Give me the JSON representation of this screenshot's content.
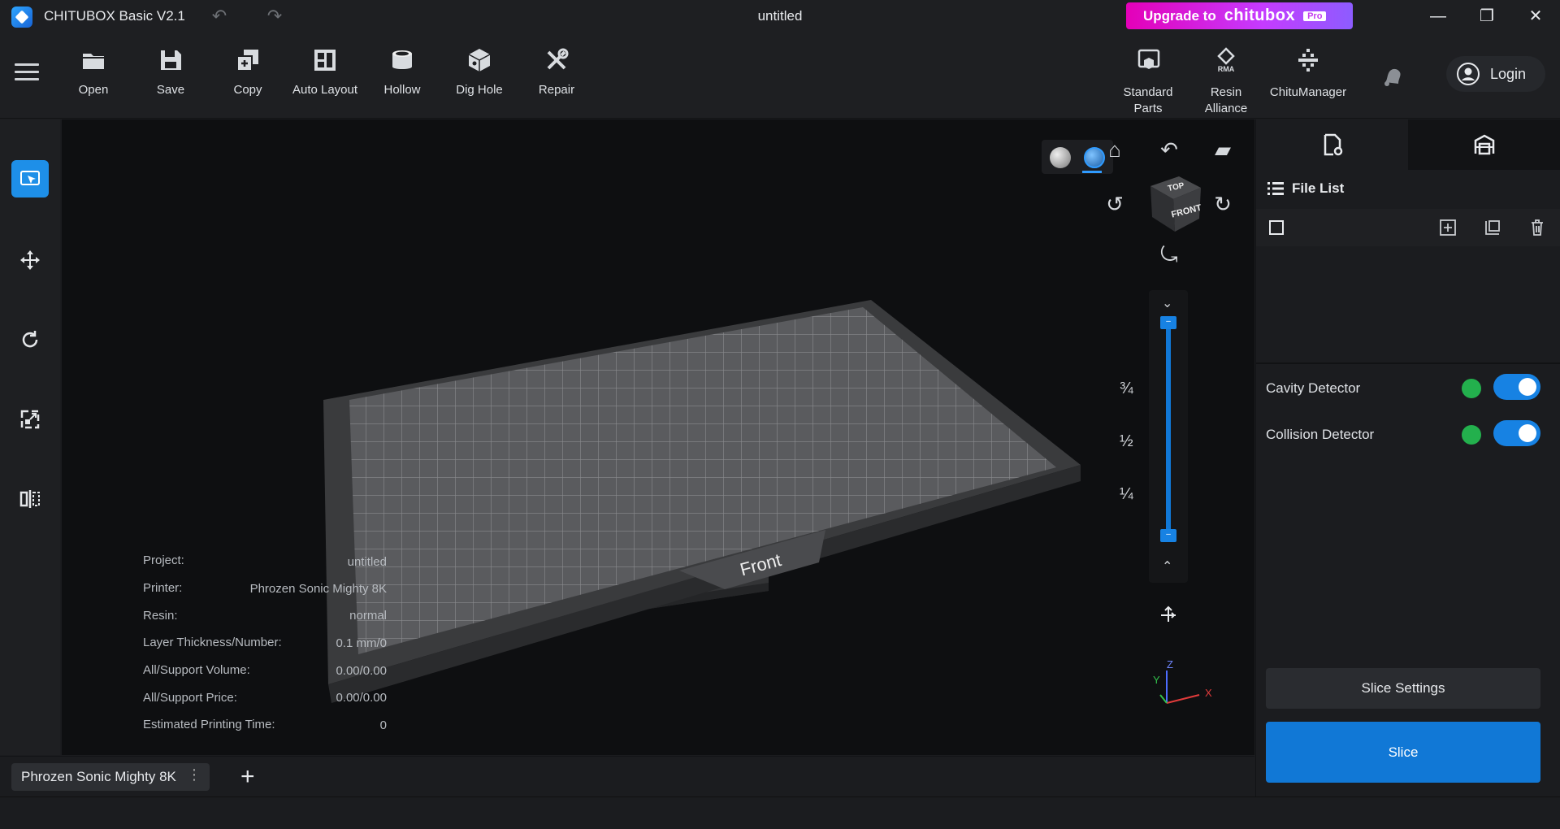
{
  "app": {
    "title": "CHITUBOX Basic V2.1",
    "document_title": "untitled"
  },
  "upgrade": {
    "prefix": "Upgrade to",
    "brand": "chitubox",
    "badge": "Pro"
  },
  "toolbar": {
    "tools": [
      {
        "label": "Open",
        "icon": "folder-icon"
      },
      {
        "label": "Save",
        "icon": "save-icon"
      },
      {
        "label": "Copy",
        "icon": "copy-icon"
      },
      {
        "label": "Auto Layout",
        "icon": "auto-layout-icon"
      },
      {
        "label": "Hollow",
        "icon": "hollow-icon"
      },
      {
        "label": "Dig Hole",
        "icon": "dig-hole-icon"
      },
      {
        "label": "Repair",
        "icon": "repair-icon"
      }
    ],
    "right_tools": [
      {
        "label_line1": "Standard",
        "label_line2": "Parts",
        "icon": "standard-parts-icon"
      },
      {
        "label_line1": "Resin",
        "label_line2": "Alliance",
        "icon": "resin-alliance-icon",
        "icon_text": "RMA"
      },
      {
        "label_line1": "ChituManager",
        "label_line2": "",
        "icon": "chitumanager-icon"
      }
    ],
    "login_label": "Login"
  },
  "viewport": {
    "cube_top": "TOP",
    "cube_front": "FRONT",
    "plate_label": "Front",
    "slider_fractions": [
      "¾",
      "½",
      "¼"
    ],
    "axes": {
      "x": "X",
      "y": "Y",
      "z": "Z"
    }
  },
  "info": {
    "rows": [
      {
        "label": "Project:",
        "value": "untitled"
      },
      {
        "label": "Printer:",
        "value": "Phrozen Sonic Mighty 8K"
      },
      {
        "label": "Resin:",
        "value": "normal"
      },
      {
        "label": "Layer Thickness/Number:",
        "value": "0.1 mm/0"
      },
      {
        "label": "All/Support Volume:",
        "value": "0.00/0.00"
      },
      {
        "label": "All/Support Price:",
        "value": "0.00/0.00"
      },
      {
        "label": "Estimated Printing Time:",
        "value": "0"
      }
    ]
  },
  "bottom": {
    "printer_tab": "Phrozen Sonic Mighty 8K",
    "add_tab": "+"
  },
  "right_panel": {
    "file_list_title": "File List",
    "detectors": [
      {
        "label": "Cavity Detector",
        "enabled": true
      },
      {
        "label": "Collision Detector",
        "enabled": true
      }
    ],
    "slice_settings_label": "Slice Settings",
    "slice_label": "Slice"
  },
  "colors": {
    "accent": "#1178d6",
    "upgrade_start": "#e400b8",
    "upgrade_end": "#8d5cff",
    "detector_ok": "#23b04d"
  }
}
